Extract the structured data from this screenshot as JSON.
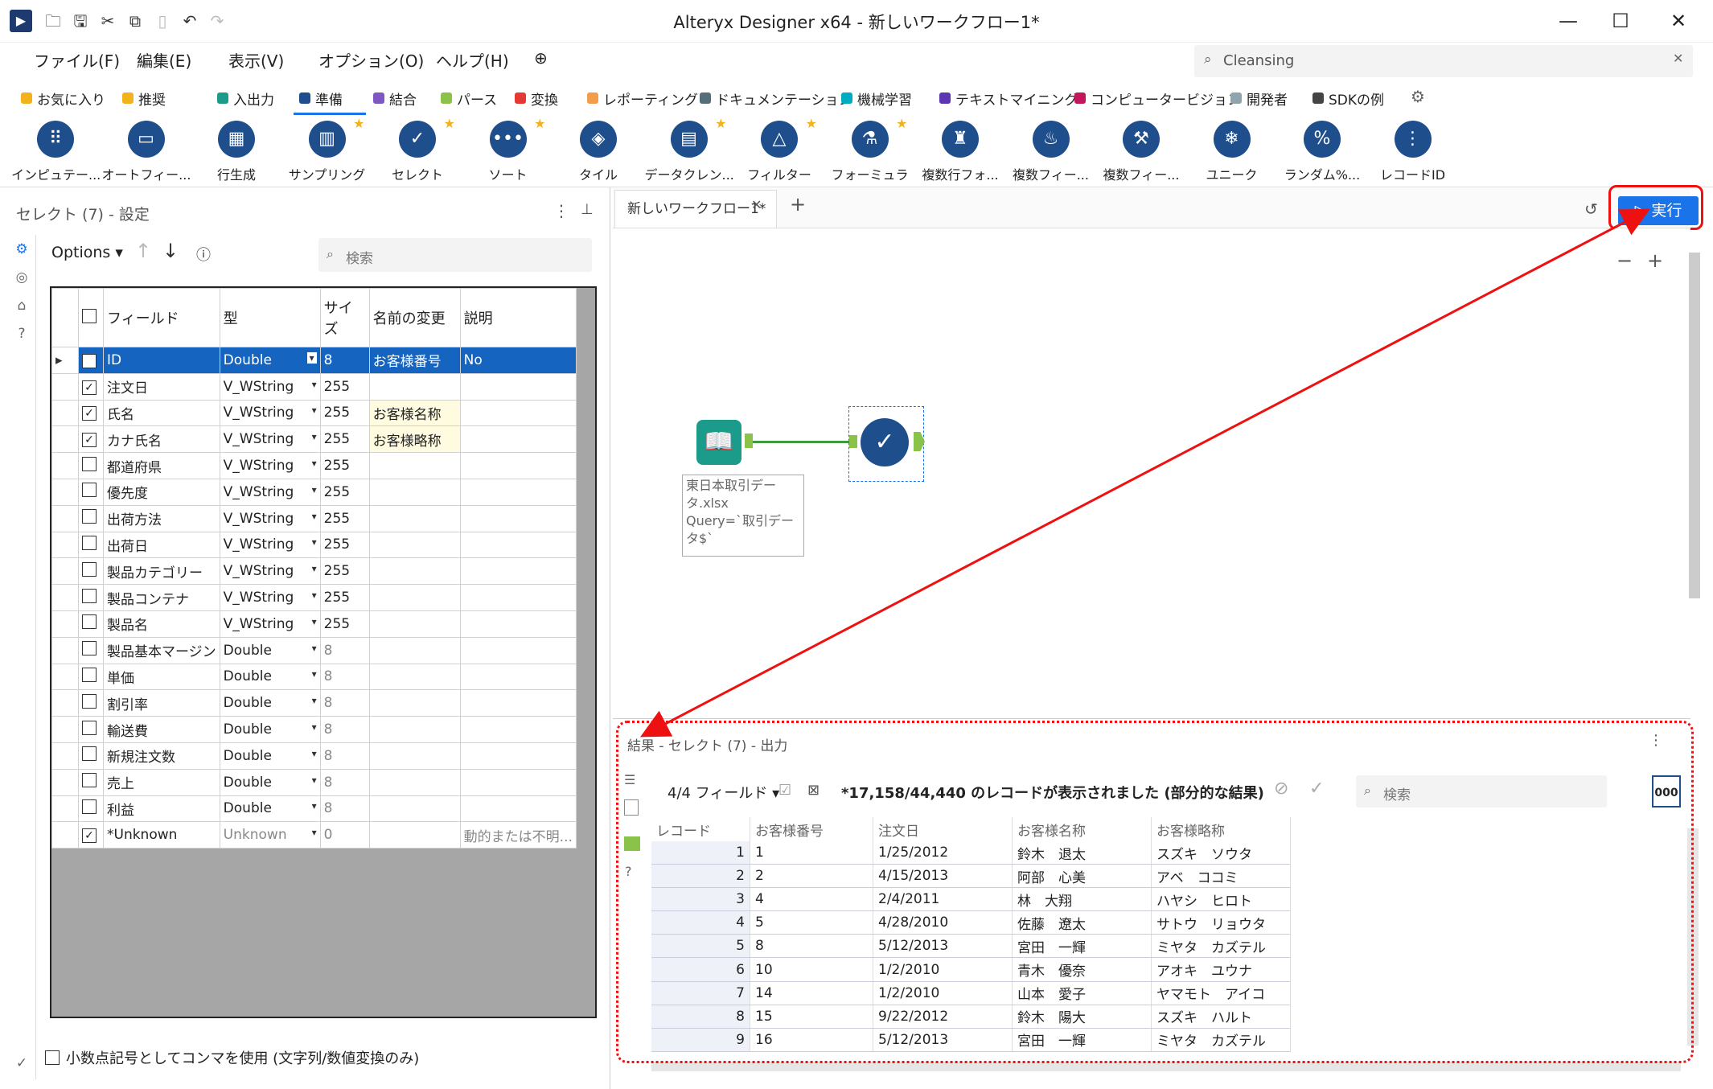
{
  "window": {
    "title": "Alteryx Designer x64 - 新しいワークフロー1*",
    "minimize": "—",
    "maximize": "☐",
    "close": "✕"
  },
  "menu": [
    "ファイル(F)",
    "編集(E)",
    "表示(V)",
    "オプション(O)",
    "ヘルプ(H)"
  ],
  "global_search": {
    "value": "Cleansing"
  },
  "categories": [
    {
      "label": "お気に入り",
      "color": "#f2b21c"
    },
    {
      "label": "推奨",
      "color": "#f2b21c"
    },
    {
      "label": "入出力",
      "color": "#1b9b8a"
    },
    {
      "label": "準備",
      "color": "#1f4e8c"
    },
    {
      "label": "結合",
      "color": "#7e57c2"
    },
    {
      "label": "パース",
      "color": "#8bc34a"
    },
    {
      "label": "変換",
      "color": "#e53935"
    },
    {
      "label": "レポーティング",
      "color": "#f39c4a"
    },
    {
      "label": "ドキュメンテーション",
      "color": "#546e7a"
    },
    {
      "label": "機械学習",
      "color": "#00acc1"
    },
    {
      "label": "テキストマイニング",
      "color": "#5e35b1"
    },
    {
      "label": "コンピュータービジョン",
      "color": "#c2185b"
    },
    {
      "label": "開発者",
      "color": "#90a4ae"
    },
    {
      "label": "SDKの例",
      "color": "#444444"
    }
  ],
  "tools": [
    {
      "label": "インピュテー...",
      "star": false
    },
    {
      "label": "オートフィー...",
      "star": false
    },
    {
      "label": "行生成",
      "star": false
    },
    {
      "label": "サンプリング",
      "star": true
    },
    {
      "label": "セレクト",
      "star": true
    },
    {
      "label": "ソート",
      "star": true
    },
    {
      "label": "タイル",
      "star": false
    },
    {
      "label": "データクレン...",
      "star": true
    },
    {
      "label": "フィルター",
      "star": true
    },
    {
      "label": "フォーミュラ",
      "star": true
    },
    {
      "label": "複数行フォ...",
      "star": false
    },
    {
      "label": "複数フィー...",
      "star": false
    },
    {
      "label": "複数フィー...",
      "star": false
    },
    {
      "label": "ユニーク",
      "star": false
    },
    {
      "label": "ランダム%...",
      "star": false
    },
    {
      "label": "レコードID",
      "star": false
    }
  ],
  "config": {
    "title": "セレクト (7) - 設定",
    "options_label": "Options",
    "search_placeholder": "検索",
    "headers": {
      "field": "フィールド",
      "type": "型",
      "size": "サイズ",
      "rename": "名前の変更",
      "description": "説明"
    },
    "rows": [
      {
        "checked": true,
        "field": "ID",
        "type": "Double",
        "size": "8",
        "rename": "お客様番号",
        "desc": "No",
        "selected": true
      },
      {
        "checked": true,
        "field": "注文日",
        "type": "V_WString",
        "size": "255",
        "rename": "",
        "desc": ""
      },
      {
        "checked": true,
        "field": "氏名",
        "type": "V_WString",
        "size": "255",
        "rename": "お客様名称",
        "desc": ""
      },
      {
        "checked": true,
        "field": "カナ氏名",
        "type": "V_WString",
        "size": "255",
        "rename": "お客様略称",
        "desc": ""
      },
      {
        "checked": false,
        "field": "都道府県",
        "type": "V_WString",
        "size": "255",
        "rename": "",
        "desc": ""
      },
      {
        "checked": false,
        "field": "優先度",
        "type": "V_WString",
        "size": "255",
        "rename": "",
        "desc": ""
      },
      {
        "checked": false,
        "field": "出荷方法",
        "type": "V_WString",
        "size": "255",
        "rename": "",
        "desc": ""
      },
      {
        "checked": false,
        "field": "出荷日",
        "type": "V_WString",
        "size": "255",
        "rename": "",
        "desc": ""
      },
      {
        "checked": false,
        "field": "製品カテゴリー",
        "type": "V_WString",
        "size": "255",
        "rename": "",
        "desc": ""
      },
      {
        "checked": false,
        "field": "製品コンテナ",
        "type": "V_WString",
        "size": "255",
        "rename": "",
        "desc": ""
      },
      {
        "checked": false,
        "field": "製品名",
        "type": "V_WString",
        "size": "255",
        "rename": "",
        "desc": ""
      },
      {
        "checked": false,
        "field": "製品基本マージン",
        "type": "Double",
        "size": "8",
        "rename": "",
        "desc": ""
      },
      {
        "checked": false,
        "field": "単価",
        "type": "Double",
        "size": "8",
        "rename": "",
        "desc": ""
      },
      {
        "checked": false,
        "field": "割引率",
        "type": "Double",
        "size": "8",
        "rename": "",
        "desc": ""
      },
      {
        "checked": false,
        "field": "輸送費",
        "type": "Double",
        "size": "8",
        "rename": "",
        "desc": ""
      },
      {
        "checked": false,
        "field": "新規注文数",
        "type": "Double",
        "size": "8",
        "rename": "",
        "desc": ""
      },
      {
        "checked": false,
        "field": "売上",
        "type": "Double",
        "size": "8",
        "rename": "",
        "desc": ""
      },
      {
        "checked": false,
        "field": "利益",
        "type": "Double",
        "size": "8",
        "rename": "",
        "desc": ""
      },
      {
        "checked": true,
        "field": "*Unknown",
        "type": "Unknown",
        "size": "0",
        "rename": "",
        "desc": "動的または不明..."
      }
    ],
    "decimal_option": "小数点記号としてコンマを使用 (文字列/数値変換のみ)"
  },
  "canvas": {
    "tab_label": "新しいワークフロー1*",
    "run_label": "▷ 実行",
    "zoom_out": "−",
    "zoom_in": "+",
    "annotation": "東日本取引データ.xlsx\nQuery=`取引データ$`"
  },
  "results": {
    "title": "結果 - セレクト (7) - 出力",
    "fields_label": "4/4 フィールド",
    "count_text": "*17,158/44,440 のレコードが表示されました (部分的な結果)",
    "search_placeholder": "検索",
    "format_btn": "000",
    "columns": [
      "レコード",
      "お客様番号",
      "注文日",
      "お客様名称",
      "お客様略称"
    ],
    "rows": [
      [
        "1",
        "1",
        "1/25/2012",
        "鈴木　退太",
        "スズキ　ソウタ"
      ],
      [
        "2",
        "2",
        "4/15/2013",
        "阿部　心美",
        "アベ　ココミ"
      ],
      [
        "3",
        "4",
        "2/4/2011",
        "林　大翔",
        "ハヤシ　ヒロト"
      ],
      [
        "4",
        "5",
        "4/28/2010",
        "佐藤　遼太",
        "サトウ　リョウタ"
      ],
      [
        "5",
        "8",
        "5/12/2013",
        "宮田　一輝",
        "ミヤタ　カズテル"
      ],
      [
        "6",
        "10",
        "1/2/2010",
        "青木　優奈",
        "アオキ　ユウナ"
      ],
      [
        "7",
        "14",
        "1/2/2010",
        "山本　愛子",
        "ヤマモト　アイコ"
      ],
      [
        "8",
        "15",
        "9/22/2012",
        "鈴木　陽大",
        "スズキ　ハルト"
      ],
      [
        "9",
        "16",
        "5/12/2013",
        "宮田　一輝",
        "ミヤタ　カズテル"
      ]
    ]
  }
}
